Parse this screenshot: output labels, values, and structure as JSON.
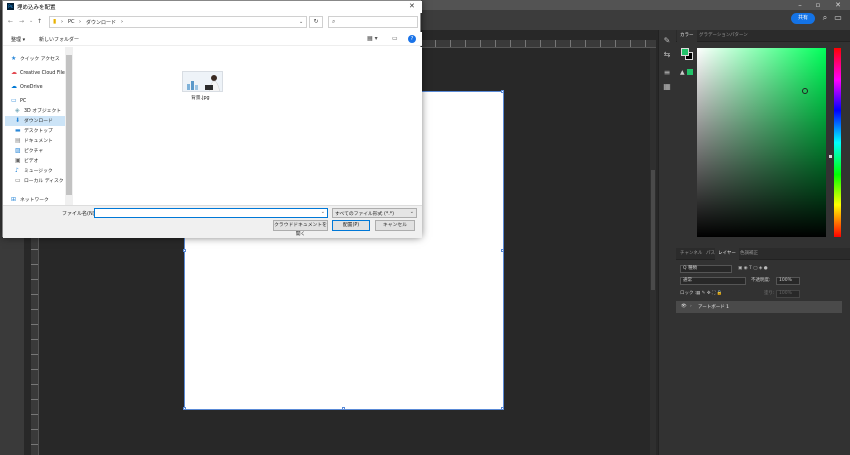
{
  "dialog": {
    "title": "埋め込みを配置",
    "title_icon": "Ps",
    "close": "✕",
    "breadcrumb": [
      "PC",
      "ダウンロード"
    ],
    "search_placeholder": "",
    "toolbar": {
      "organize": "整理 ▾",
      "new_folder": "新しいフォルダー",
      "help": "?"
    },
    "nav_items": [
      {
        "label": "クイック アクセス",
        "icon": "star-icon"
      },
      {
        "label": "Creative Cloud Files",
        "icon": "cloud-icon"
      },
      {
        "label": "OneDrive",
        "icon": "onedrive-icon"
      },
      {
        "label": "PC",
        "icon": "pc-icon"
      },
      {
        "label": "3D オブジェクト",
        "icon": "cube-icon"
      },
      {
        "label": "ダウンロード",
        "icon": "download-icon",
        "selected": true
      },
      {
        "label": "デスクトップ",
        "icon": "desktop-icon"
      },
      {
        "label": "ドキュメント",
        "icon": "document-icon"
      },
      {
        "label": "ピクチャ",
        "icon": "picture-icon"
      },
      {
        "label": "ビデオ",
        "icon": "video-icon"
      },
      {
        "label": "ミュージック",
        "icon": "music-icon"
      },
      {
        "label": "ローカル ディスク (C",
        "icon": "disk-icon"
      },
      {
        "label": "ネットワーク",
        "icon": "network-icon"
      }
    ],
    "file": {
      "name": "背景.jpg"
    },
    "filename_label": "ファイル名(N):",
    "filename_value": "",
    "filetype_selected": "すべてのファイル形式 (*.*)",
    "buttons": {
      "cloud": "クラウドドキュメントを開く",
      "place": "配置(P)",
      "cancel": "キャンセル"
    }
  },
  "photoshop": {
    "share_label": "共有",
    "right_tabs": [
      "カラー",
      "グラデーション",
      "パターン"
    ],
    "layer_tabs": [
      "チャンネル",
      "パス",
      "レイヤー",
      "色調補正"
    ],
    "layers": {
      "filter": "Q 種類",
      "blend_mode": "通常",
      "opacity_label": "不透明度:",
      "opacity_value": "100%",
      "lock_label": "ロック :",
      "fill_label": "塗り:",
      "fill_value": "100%",
      "items": [
        {
          "name": "アートボード 1"
        }
      ]
    },
    "foreground_color": "#22c46a",
    "background_color": "#000000",
    "accent_color": "#1473e6"
  }
}
